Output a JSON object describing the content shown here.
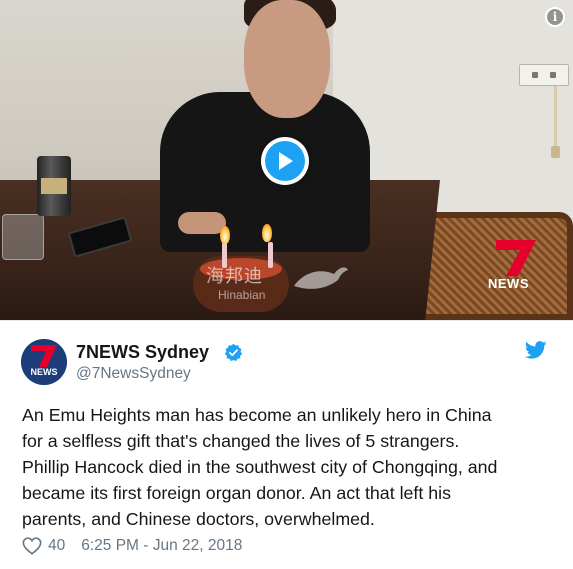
{
  "media": {
    "watermark_text": "海邦迪",
    "watermark_sub": "Hinabian",
    "news_logo_text": "NEWS",
    "info_icon": "info-icon",
    "play_icon": "play-icon",
    "brand_blue": "#1da1f2"
  },
  "tweet": {
    "display_name": "7NEWS Sydney",
    "handle": "@7NewsSydney",
    "verified_icon": "verified-badge-icon",
    "avatar_text": "NEWS",
    "text_lines": [
      "An Emu Heights man has become an unlikely hero in China",
      "for a selfless gift that's changed the lives of 5 strangers.",
      "Phillip Hancock died in the southwest city of Chongqing, and",
      "became its first foreign organ donor. An act that left his",
      "parents, and Chinese doctors, overwhelmed."
    ],
    "like_count": "40",
    "timestamp": "6:25 PM - Jun 22, 2018",
    "twitter_icon": "twitter-bird-icon",
    "like_icon": "heart-icon"
  },
  "colors": {
    "text_primary": "#14171a",
    "text_secondary": "#657786",
    "verified_blue": "#1da1f2",
    "news_red": "#e4002b"
  }
}
